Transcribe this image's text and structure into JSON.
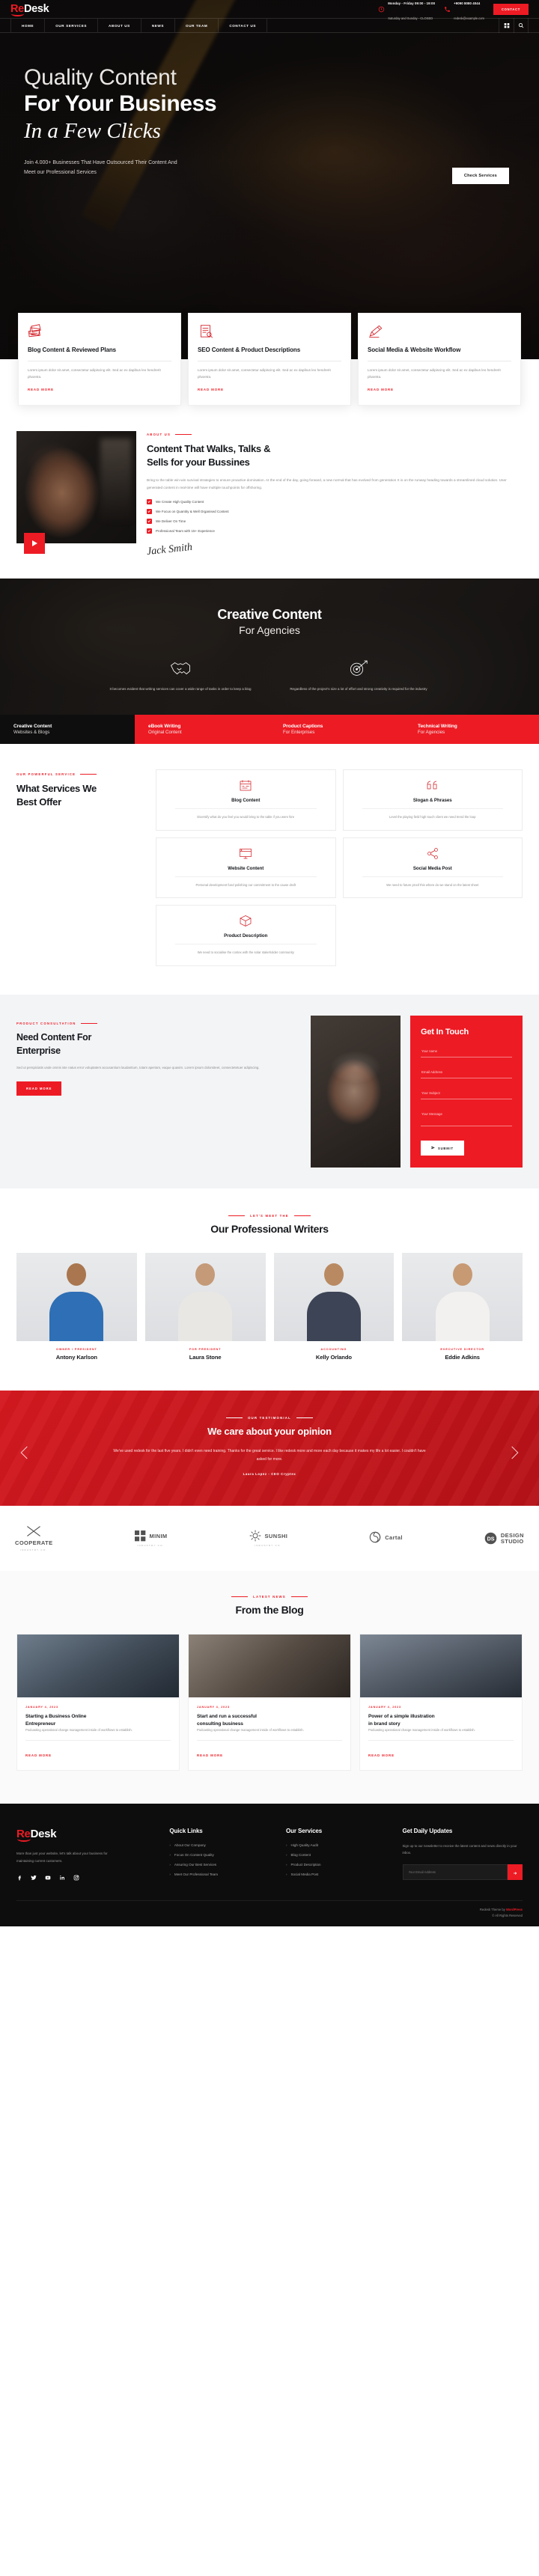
{
  "brand": {
    "part1": "Re",
    "part2": "Desk"
  },
  "topbar": {
    "hours_line1": "Monday - Friday 09:00 - 19:00",
    "hours_line2": "Saturday and Sunday - CLOSED",
    "phone_line1": "+9090 8080 4044",
    "phone_line2": "redesk@example.com",
    "contact_button": "CONTACT",
    "clock_icon": "clock-icon",
    "phone_icon": "phone-icon"
  },
  "nav": {
    "items": [
      {
        "label": "HOME"
      },
      {
        "label": "OUR SERVICES"
      },
      {
        "label": "ABOUT US"
      },
      {
        "label": "NEWS"
      },
      {
        "label": "OUR TEAM"
      },
      {
        "label": "CONTACT US"
      }
    ],
    "grid_icon": "grid-menu-icon",
    "search_icon": "search-icon"
  },
  "hero": {
    "line1": "Quality Content",
    "line2": "For Your Business",
    "line3": "In a Few Clicks",
    "sub_line1": "Join 4.000+ Businesses That Have Outsourced Their Content And",
    "sub_line2": "Meet our Professional Services",
    "cta": "Check Services"
  },
  "feature_cards": [
    {
      "icon": "documents-stack-icon",
      "title": "Blog Content & Reviewed Plans",
      "text": "Lorem ipsum dolor sit amet, consectetur adipiscing elit. Sed ac ex dapibus leo hendrerit pharetra.",
      "link": "READ MORE"
    },
    {
      "icon": "seo-document-icon",
      "title": "SEO Content & Product Descriptions",
      "text": "Lorem ipsum dolor sit amet, consectetur adipiscing elit. Sed ac ex dapibus leo hendrerit pharetra.",
      "link": "READ MORE"
    },
    {
      "icon": "pencil-ruler-icon",
      "title": "Social Media & Website Workflow",
      "text": "Lorem ipsum dolor sit amet, consectetur adipiscing elit. Sed ac ex dapibus leo hendrerit pharetra.",
      "link": "READ MORE"
    }
  ],
  "about": {
    "eyebrow": "ABOUT US",
    "heading_line1": "Content That Walks, Talks &",
    "heading_line2": "Sells for your Bussines",
    "paragraph": "Bring to the table win-win survival strategies to ensure proactive domination. At the end of the day, going forward, a new normal that has evolved from generation X is on the runway heading towards a streamlined cloud solution. User generated content in real-time will have multiple touchpoints for offshoring.",
    "bullets": [
      "We Create High Quality Content",
      "We Focus on Quantity & Well Organised Content",
      "We Deliver On Time",
      "Professional Team with 15+ Experience"
    ],
    "signature": "Jack Smith",
    "play_icon": "play-icon"
  },
  "banner": {
    "title_line1": "Creative Content",
    "title_line2": "For Agencies",
    "columns": [
      {
        "icon": "handshake-icon",
        "text": "It becomes evident that writing services can cover a wide range of tasks in order to keep a blog"
      },
      {
        "icon": "target-arrow-icon",
        "text": "Regardless of the project's size a lot of effort and strong creativity is required for the industry"
      }
    ],
    "tabs": [
      {
        "title": "Creative Content",
        "subtitle": "Websites & Blogs",
        "active": true
      },
      {
        "title": "eBook Writing",
        "subtitle": "Original Content",
        "active": false
      },
      {
        "title": "Product Captions",
        "subtitle": "For Enterprises",
        "active": false
      },
      {
        "title": "Technical Writing",
        "subtitle": "For Agencies",
        "active": false
      }
    ]
  },
  "services": {
    "eyebrow": "OUR POWERFUL SERVICE",
    "heading_line1": "What Services We",
    "heading_line2": "Best Offer",
    "cards": [
      {
        "icon": "blog-calendar-icon",
        "title": "Blog Content",
        "text": "Diversify what do you feel you would bring to the table if you were hire"
      },
      {
        "icon": "quote-icon",
        "title": "Slogan & Phrases",
        "text": "Level the playing field high touch client we need trend the loop"
      },
      {
        "icon": "monitor-icon",
        "title": "Website Content",
        "text": "Personal development fund polishing our commitment to the cause draft"
      },
      {
        "icon": "share-nodes-icon",
        "title": "Social Media Post",
        "text": "We need to future proof this where do we stand on the latest sheet"
      },
      {
        "icon": "box-icon",
        "title": "Product Description",
        "text": "We need to socialise the contex with the solar stakeholder community"
      }
    ]
  },
  "enterprise": {
    "eyebrow": "PRODUCT CONSULTATION",
    "heading_line1": "Need Content For",
    "heading_line2": "Enterprise",
    "paragraph": "Sed ut perspiciatis unde omnis iste natus error voluptatem accusantium laudantium, totam aperiam, eaque quasim. Lorem ipsum dolorsiteet, consectetetuer adipiscing.",
    "button": "READ MORE"
  },
  "contact_form": {
    "title": "Get In Touch",
    "fields": [
      {
        "name": "name-field",
        "placeholder": "Your name",
        "value": ""
      },
      {
        "name": "email-field",
        "placeholder": "Email Address",
        "value": ""
      },
      {
        "name": "subject-field",
        "placeholder": "Your Subject",
        "value": ""
      },
      {
        "name": "message-field",
        "placeholder": "Your Message",
        "value": ""
      }
    ],
    "submit": "SUBMIT",
    "submit_icon": "paper-plane-icon"
  },
  "team": {
    "eyebrow": "LET'S MEET THE",
    "heading": "Our Professional Writers",
    "members": [
      {
        "role": "OWNER / PRESIDENT",
        "name": "Antony Karlson"
      },
      {
        "role": "FOR PRESIDENT",
        "name": "Laura Stone"
      },
      {
        "role": "ACCOUNTING",
        "name": "Kelly Orlando"
      },
      {
        "role": "EXECUTIVE DIRECTOR",
        "name": "Eddie Adkins"
      }
    ]
  },
  "testimonial": {
    "eyebrow": "OUR TESTIMONIAL",
    "heading": "We care about your opinion",
    "quote": "We've used redesk for the last five years. I didn't even need training. Thanks for the great service. I like redesk more and more each day because it makes my life a lot easier. I couldn't have asked for more.",
    "author": "Laura Lopez - CEO Cryptex",
    "prev_icon": "chevron-left-icon",
    "next_icon": "chevron-right-icon"
  },
  "logos": [
    {
      "icon": "arrows-cross-icon",
      "name": "COOPERATE",
      "sub": "INDUSTRY CO."
    },
    {
      "icon": "squares-icon",
      "name": "MINIM",
      "sub": "INDUSTRY CO."
    },
    {
      "icon": "sun-burst-icon",
      "name": "SUNSHI",
      "sub": "INDUSTRY CO."
    },
    {
      "icon": "circle-swirl-icon",
      "name": "Cartal",
      "sub": ""
    },
    {
      "icon": "ds-circle-icon",
      "name": "DESIGN",
      "sub": "STUDIO"
    }
  ],
  "blog": {
    "eyebrow": "LATEST NEWS",
    "heading": "From the Blog",
    "posts": [
      {
        "date": "JANUARY 4, 2023",
        "title_line1": "Starting a Business Online",
        "title_line2": "Entrepreneur",
        "text": "Podcasting operational change management inside of workflows to establish.",
        "link": "READ MORE"
      },
      {
        "date": "JANUARY 4, 2023",
        "title_line1": "Start and run a successful",
        "title_line2": "consulting business",
        "text": "Podcasting operational change management inside of workflows to establish.",
        "link": "READ MORE"
      },
      {
        "date": "JANUARY 4, 2023",
        "title_line1": "Power of a simple illustration",
        "title_line2": "in brand story",
        "text": "Podcasting operational change management inside of workflows to establish.",
        "link": "READ MORE"
      }
    ]
  },
  "footer": {
    "about": "More than just your website, let's talk about your business for maintaining current customers.",
    "social": [
      "facebook-icon",
      "twitter-icon",
      "youtube-icon",
      "linkedin-icon",
      "instagram-icon"
    ],
    "quick_links_title": "Quick Links",
    "quick_links": [
      "About Our Company",
      "Focus On Content Quality",
      "Assuring Our Best Services",
      "Meet Our Professional Team"
    ],
    "services_title": "Our Services",
    "services": [
      "High Quality Audit",
      "Blog Content",
      "Product Description",
      "Social Media Post"
    ],
    "newsletter_title": "Get Daily Updates",
    "newsletter_text": "Sign up to our newsletter to receive the latest content and news directly in your inbox.",
    "newsletter_placeholder": "Your Email Address",
    "newsletter_icon": "arrow-right-icon",
    "credit_prefix": "Redesk",
    "credit_mid": " Theme by ",
    "credit_brand": "WordPress",
    "rights": "© All Rights Reserved"
  },
  "colors": {
    "accent": "#ed1b24",
    "dark": "#0d0d0d",
    "muted": "#8d8d8d"
  }
}
